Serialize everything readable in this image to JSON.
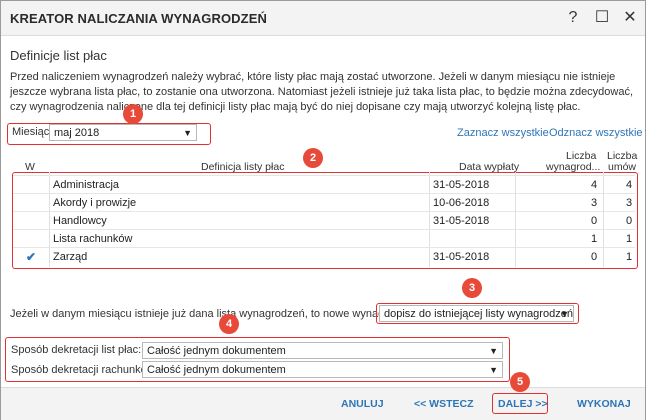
{
  "window": {
    "title": "KREATOR NALICZANIA WYNAGRODZEŃ",
    "help": "?",
    "maximize": "☐",
    "close": "✕"
  },
  "section": {
    "title": "Definicje list płac"
  },
  "description": "Przed naliczeniem wynagrodzeń należy wybrać, które listy płac mają zostać utworzone. Jeżeli w danym miesiącu nie istnieje jeszcze wybrana lista płac, to zostanie ona utworzona. Natomiast jeżeli istnieje już taka lista płac, to będzie można zdecydować, czy wynagrodzenia naliczone dla tej definicji listy płac mają być do niej dopisane czy mają utworzyć kolejną listę płac.",
  "month": {
    "label": "Miesiąc:",
    "value": "maj 2018"
  },
  "links": {
    "select_all": "Zaznacz wszystkie",
    "deselect_all": "Odznacz wszystkie"
  },
  "table": {
    "headers": {
      "w": "W",
      "definition": "Definicja listy płac",
      "payment_date": "Data wypłaty",
      "payrolls_1": "Liczba",
      "payrolls_2": "wynagrod...",
      "contracts_1": "Liczba",
      "contracts_2": "umów"
    },
    "rows": [
      {
        "checked": "",
        "name": "Administracja",
        "date": "31-05-2018",
        "payrolls": "4",
        "contracts": "4"
      },
      {
        "checked": "",
        "name": "Akordy i prowizje",
        "date": "10-06-2018",
        "payrolls": "3",
        "contracts": "3"
      },
      {
        "checked": "",
        "name": "Handlowcy",
        "date": "31-05-2018",
        "payrolls": "0",
        "contracts": "0"
      },
      {
        "checked": "",
        "name": "Lista rachunków",
        "date": "",
        "payrolls": "1",
        "contracts": "1"
      },
      {
        "checked": "✔",
        "name": "Zarząd",
        "date": "31-05-2018",
        "payrolls": "0",
        "contracts": "1"
      }
    ]
  },
  "existing": {
    "label": "Jeżeli w danym miesiącu istnieje już dana lista wynagrodzeń, to nowe wynagrodzenia:",
    "value": "dopisz do istniejącej listy wynagrodzeń"
  },
  "decretation": {
    "payroll_label": "Sposób dekretacji list płac:",
    "payroll_value": "Całość jednym dokumentem",
    "bills_label": "Sposób dekretacji rachunków:",
    "bills_value": "Całość jednym dokumentem"
  },
  "badges": [
    "1",
    "2",
    "3",
    "4",
    "5"
  ],
  "footer": {
    "cancel": "ANULUJ",
    "back": "<< WSTECZ",
    "next": "DALEJ >>",
    "run": "WYKONAJ"
  },
  "colors": {
    "accent": "#2e75b6",
    "highlight": "#e03030",
    "badge": "#e84a3a"
  }
}
